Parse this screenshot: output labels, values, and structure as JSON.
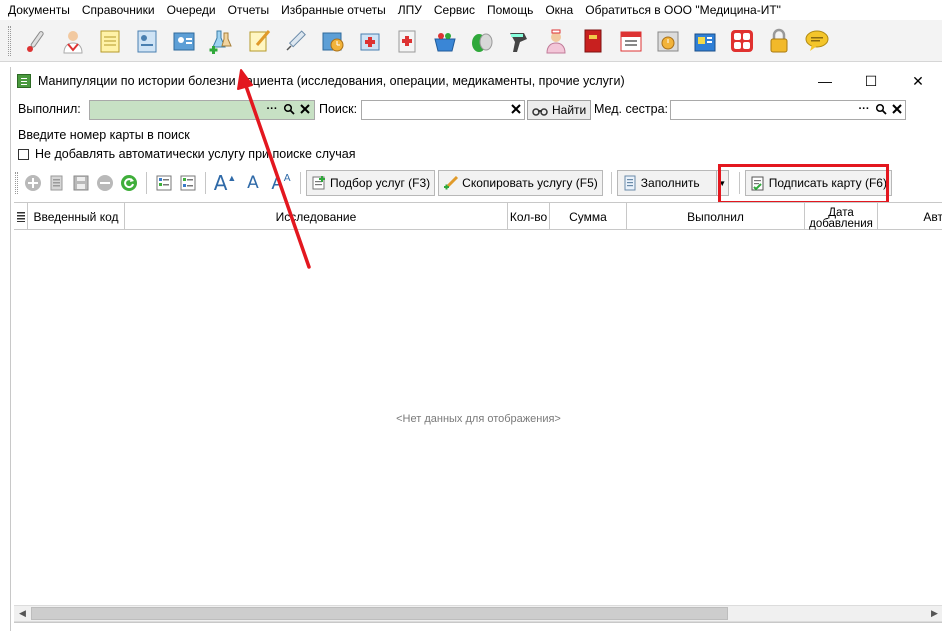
{
  "menu": [
    "Документы",
    "Справочники",
    "Очереди",
    "Отчеты",
    "Избранные отчеты",
    "ЛПУ",
    "Сервис",
    "Помощь",
    "Окна",
    "Обратиться в ООО \"Медицина-ИТ\""
  ],
  "toolbar_icons": [
    "thermometer-icon",
    "doctor-icon",
    "notebook-icon",
    "patient-card-icon",
    "patient-id-icon",
    "lab-flasks-add-icon",
    "notepad-pencil-icon",
    "syringe-icon",
    "clock-calendar-icon",
    "medicine-box-icon",
    "first-aid-icon",
    "shopping-basket-icon",
    "pills-icon",
    "barcode-scanner-icon",
    "nurse-icon",
    "red-book-icon",
    "calendar-sheet-icon",
    "schedule-clock-icon",
    "money-register-icon",
    "apps-grid-icon",
    "padlock-icon",
    "speech-bubble-icon"
  ],
  "window": {
    "title": "Манипуляции по истории болезни пациента (исследования, операции, медикаменты, прочие услуги)",
    "minimize": "—",
    "maximize": "☐",
    "close": "✕"
  },
  "filters": {
    "performed_label": "Выполнил:",
    "performed_value": "",
    "search_label": "Поиск:",
    "search_value": "",
    "find_button": "Найти",
    "nurse_label": "Мед. сестра:",
    "nurse_value": "",
    "dots": "···"
  },
  "hint": "Введите номер карты в поиск",
  "auto_service_checkbox": {
    "label": "Не добавлять автоматически услугу при поиске случая",
    "checked": false
  },
  "actions": {
    "select_services": "Подбор услуг (F3)",
    "copy_service": "Скопировать услугу (F5)",
    "fill": "Заполнить",
    "sign_card": "Подписать карту (F6)"
  },
  "font_sizes": [
    "A",
    "A",
    "A"
  ],
  "grid": {
    "columns": [
      "Введенный код",
      "Исследование",
      "Кол-во",
      "Сумма",
      "Выполнил",
      "Дата добавления",
      "Авт"
    ],
    "rows": [],
    "empty_text": "<Нет данных для отображения>"
  },
  "colors": {
    "performed_field_bg": "#c7e1c4",
    "highlight": "#e3171f"
  }
}
